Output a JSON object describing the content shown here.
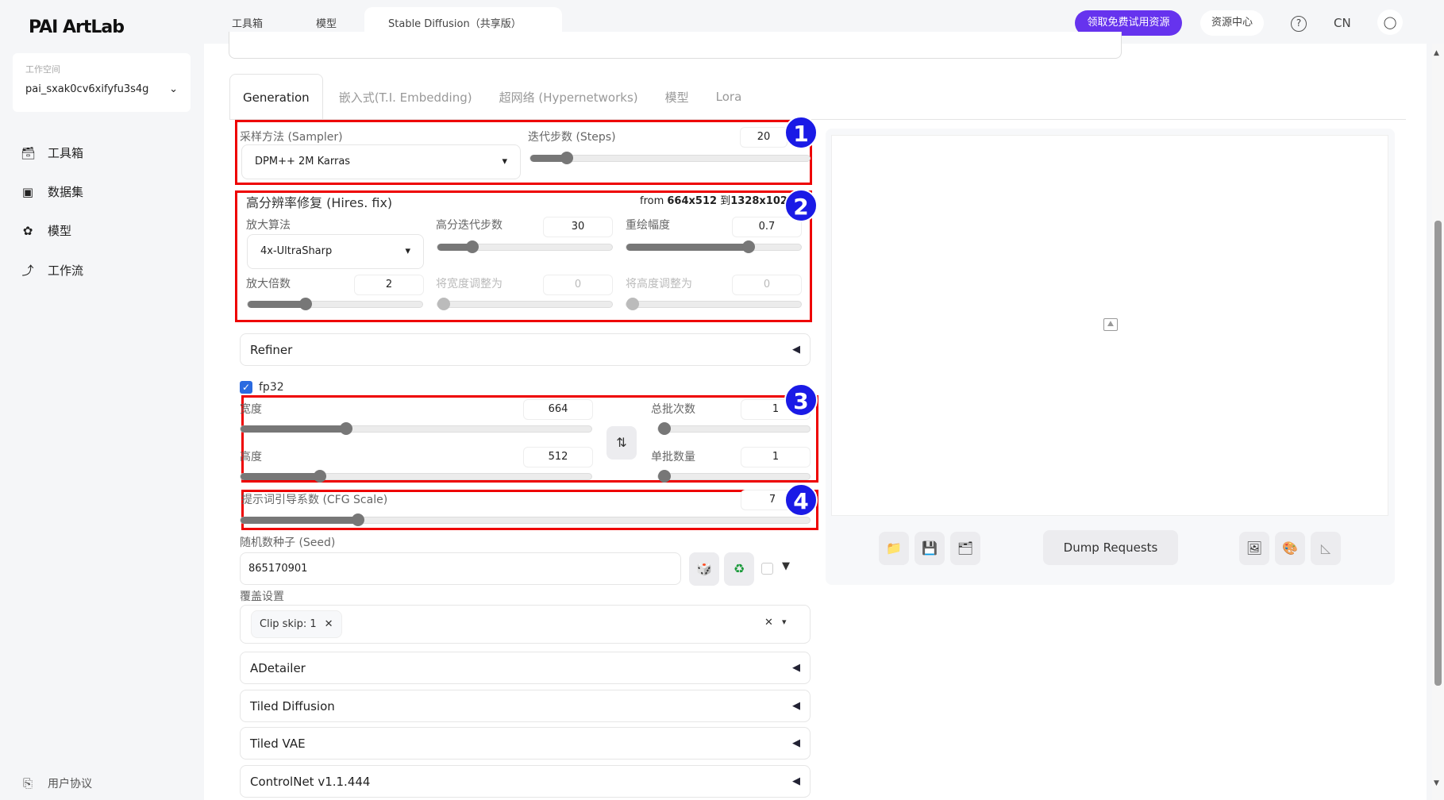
{
  "app": {
    "logo": "PAI ArtLab"
  },
  "top_tabs": [
    {
      "label": "工具箱"
    },
    {
      "label": "模型"
    },
    {
      "label": "Stable Diffusion（共享版）",
      "close": "x"
    }
  ],
  "header": {
    "promo": "领取免费试用资源",
    "resources": "资源中心",
    "help": "?",
    "lang": "CN"
  },
  "sidebar": {
    "workspace_label": "工作空间",
    "workspace": "pai_sxak0cv6xifyfu3s4g",
    "items": [
      {
        "label": "工具箱",
        "icon": "toolbox-icon"
      },
      {
        "label": "数据集",
        "icon": "dataset-icon"
      },
      {
        "label": "模型",
        "icon": "model-icon"
      },
      {
        "label": "工作流",
        "icon": "workflow-icon"
      }
    ],
    "footer": "用户协议"
  },
  "gen_tabs": [
    "Generation",
    "嵌入式(T.I. Embedding)",
    "超网络 (Hypernetworks)",
    "模型",
    "Lora"
  ],
  "badges": [
    "1",
    "2",
    "3",
    "4"
  ],
  "sampler": {
    "label": "采样方法 (Sampler)",
    "value": "DPM++ 2M Karras"
  },
  "steps": {
    "label": "迭代步数 (Steps)",
    "value": "20",
    "fill": 0.13
  },
  "hires": {
    "title": "高分辨率修复 (Hires. fix)",
    "info_prefix": "from ",
    "info_from": "664x512",
    "info_mid": " 到",
    "info_to": "1328x1024",
    "upscaler_label": "放大算法",
    "upscaler": "4x-UltraSharp",
    "hr_steps_label": "高分迭代步数",
    "hr_steps": "30",
    "hr_steps_fill": 0.2,
    "denoise_label": "重绘幅度",
    "denoise": "0.7",
    "denoise_fill": 0.7,
    "scale_label": "放大倍数",
    "scale": "2",
    "scale_fill": 0.33,
    "resize_w_label": "将宽度调整为",
    "resize_w": "0",
    "resize_h_label": "将高度调整为",
    "resize_h": "0"
  },
  "refiner": "Refiner",
  "fp32": {
    "label": "fp32",
    "checked": true
  },
  "width": {
    "label": "宽度",
    "value": "664",
    "fill": 0.3
  },
  "height": {
    "label": "高度",
    "value": "512",
    "fill": 0.226
  },
  "swap": "⇅",
  "batch_count": {
    "label": "总批次数",
    "value": "1",
    "fill": 0
  },
  "batch_size": {
    "label": "单批数量",
    "value": "1",
    "fill": 0
  },
  "cfg": {
    "label": "提示词引导系数 (CFG Scale)",
    "value": "7",
    "fill": 0.207
  },
  "seed": {
    "label": "随机数种子 (Seed)",
    "value": "865170901"
  },
  "override": {
    "label": "覆盖设置",
    "chip": "Clip skip: 1"
  },
  "accordions": [
    "ADetailer",
    "Tiled Diffusion",
    "Tiled VAE",
    "ControlNet v1.1.444"
  ],
  "output": {
    "dump": "Dump Requests"
  }
}
